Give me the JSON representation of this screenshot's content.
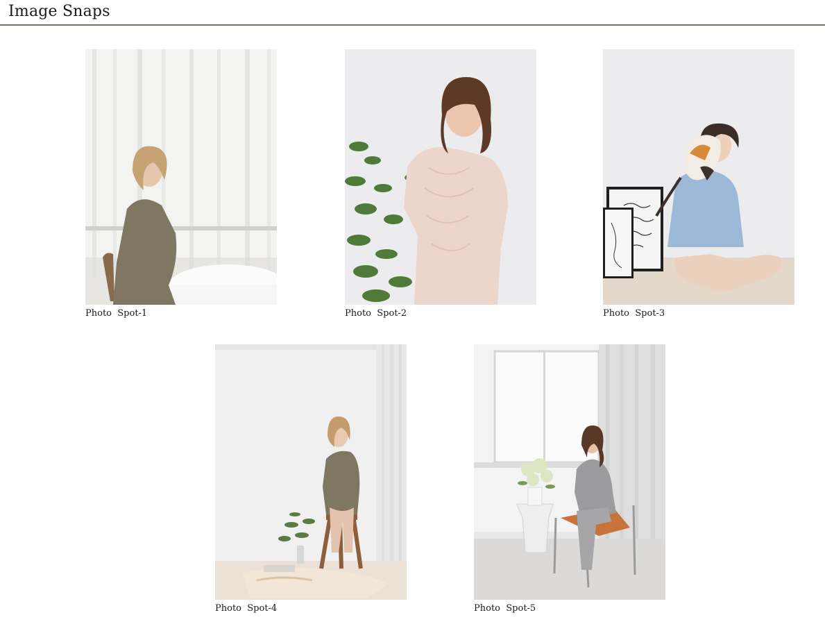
{
  "page": {
    "title": "Image Snaps",
    "accent_color": "#8a6a52"
  },
  "gallery": {
    "items": [
      {
        "caption": "Photo  Spot-1",
        "image_alt": "woman in olive dress seated at white round table by sheer curtains"
      },
      {
        "caption": "Photo  Spot-2",
        "image_alt": "woman in blush lace dress standing beside green plant"
      },
      {
        "caption": "Photo  Spot-3",
        "image_alt": "woman in blue shirt sitting on floor holding calico cat beside framed prints"
      },
      {
        "caption": "Photo  Spot-4",
        "image_alt": "woman in olive dress seated on wooden stool in white studio corner"
      },
      {
        "caption": "Photo  Spot-5",
        "image_alt": "woman in grey suit seated in leather sling chair by window"
      }
    ]
  }
}
